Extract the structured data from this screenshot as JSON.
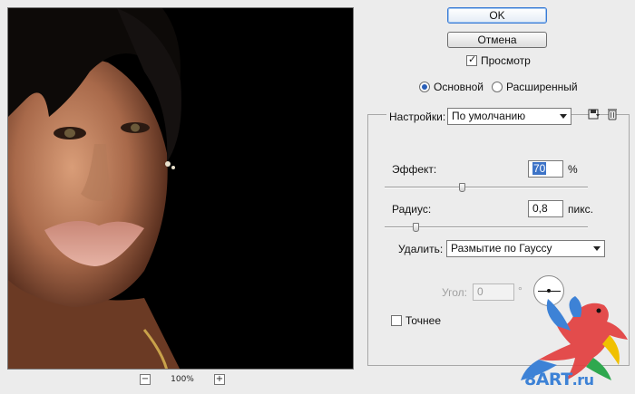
{
  "buttons": {
    "ok": "OK",
    "cancel": "Отмена"
  },
  "preview_toggle": {
    "label": "Просмотр",
    "checked": true
  },
  "mode": {
    "basic": "Основной",
    "advanced": "Расширенный",
    "selected": "basic"
  },
  "settings": {
    "label": "Настройки:",
    "value": "По умолчанию"
  },
  "effect": {
    "label": "Эффект:",
    "value": "70",
    "unit": "%",
    "slider_fraction": 0.38
  },
  "radius": {
    "label": "Радиус:",
    "value": "0,8",
    "unit": "пикс.",
    "slider_fraction": 0.15
  },
  "remove": {
    "label": "Удалить:",
    "value": "Размытие по Гауссу"
  },
  "angle": {
    "label": "Угол:",
    "value": "0",
    "unit": "°"
  },
  "precise": {
    "label": "Точнее",
    "checked": false
  },
  "zoom": {
    "minus": "−",
    "level": "100%",
    "plus": "+"
  },
  "watermark": {
    "text": "8ART",
    "suffix": ".ru"
  },
  "icons": [
    "save-preset-icon",
    "delete-preset-icon",
    "dropdown-arrow-icon",
    "checkbox-check-icon",
    "angle-dial-icon",
    "parrot-logo-icon"
  ]
}
